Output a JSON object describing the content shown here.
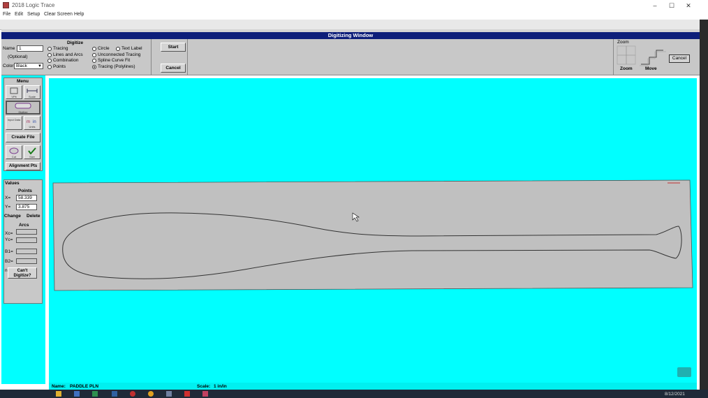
{
  "window": {
    "title": "2018 Logic Trace",
    "minimize": "–",
    "maximize": "☐",
    "close": "✕"
  },
  "menu": [
    "File",
    "Edit",
    "Setup",
    "Clear Screen",
    "Help"
  ],
  "digitizing_window_title": "Digitizing Window",
  "top": {
    "name_label": "Name",
    "name_value": "1",
    "optional_label": "(Optional)",
    "color_label": "Color",
    "color_value": "Black",
    "digitize_label": "Digitize",
    "options_left": [
      "Tracing",
      "Lines and Arcs",
      "Combination",
      "Points"
    ],
    "options_right": [
      "Circle",
      "Unconnected Tracing",
      "Spline Curve Fit",
      "Tracing (Polylines)"
    ],
    "text_label_option": "Text Label",
    "selected_option": "Tracing (Polylines)",
    "start_button": "Start",
    "cancel_button": "Cancel",
    "zoom_title": "Zoom",
    "zoom_label": "Zoom",
    "move_label": "Move",
    "zoom_cancel_button": "Cancel"
  },
  "left": {
    "menu_title": "Menu",
    "icons": {
      "vpit": "VPit",
      "scale": "Scale",
      "digitize": "Digitize",
      "input_data": "Input Data",
      "units": "Units",
      "cut": "Cut",
      "size": "Size"
    },
    "create_file_button": "Create File",
    "alignment_button": "Alignment Pts",
    "values_title": "Values",
    "points_title": "Points",
    "x_label": "X=",
    "x_value": "58.339",
    "y_label": "Y=",
    "y_value": "3.875",
    "change_button": "Change",
    "delete_button": "Delete",
    "arcs_title": "Arcs",
    "xc_label": "Xc=",
    "yc_label": "Yc=",
    "b1_label": "B1=",
    "b2_label": "B2=",
    "n_label": "n",
    "cant_digitize_button": "Can't Digitize?"
  },
  "status": {
    "name_label": "Name:",
    "name_value": "PADDLE PLN",
    "scale_label": "Scale:",
    "scale_value": "1 in/in"
  },
  "taskbar": {
    "date": "8/12/2021"
  },
  "colors": {
    "canvas": "#00ffff",
    "title_bar": "#0d1e7a",
    "panel": "#c8c8c8",
    "shape": "#c0c0c0"
  }
}
